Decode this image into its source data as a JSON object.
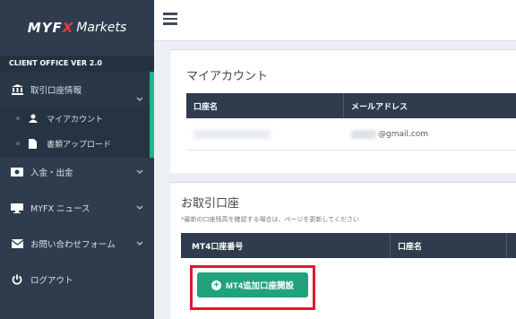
{
  "logo": {
    "brand_a": "MYF",
    "brand_x": "X",
    "brand_b": "Markets"
  },
  "sidebar": {
    "version": "CLIENT OFFICE VER 2.0",
    "items": [
      {
        "label": "取引口座情報",
        "icon": "bank-icon"
      },
      {
        "label": "入金・出金",
        "icon": "money-icon"
      },
      {
        "label": "MYFX ニュース",
        "icon": "monitor-icon"
      },
      {
        "label": "お問い合わせフォーム",
        "icon": "envelope-icon"
      },
      {
        "label": "ログアウト",
        "icon": "power-icon"
      }
    ],
    "sub_items": [
      {
        "label": "マイアカウント",
        "icon": "user-icon"
      },
      {
        "label": "書類アップロード",
        "icon": "document-icon"
      }
    ]
  },
  "account": {
    "title": "マイアカウント",
    "headers": [
      "口座名",
      "メールアドレス"
    ],
    "email_suffix": "@gmail.com"
  },
  "trading": {
    "title": "お取引口座",
    "note": "*最新の口座残高を確認する場合は、ページを更新してください",
    "headers": [
      "MT4口座番号",
      "口座名"
    ],
    "open_button": "MT4追加口座開設"
  },
  "colors": {
    "sidebar": "#2e3c4d",
    "accent": "#20b58a",
    "button": "#20a37c",
    "highlight": "#e0192b"
  }
}
